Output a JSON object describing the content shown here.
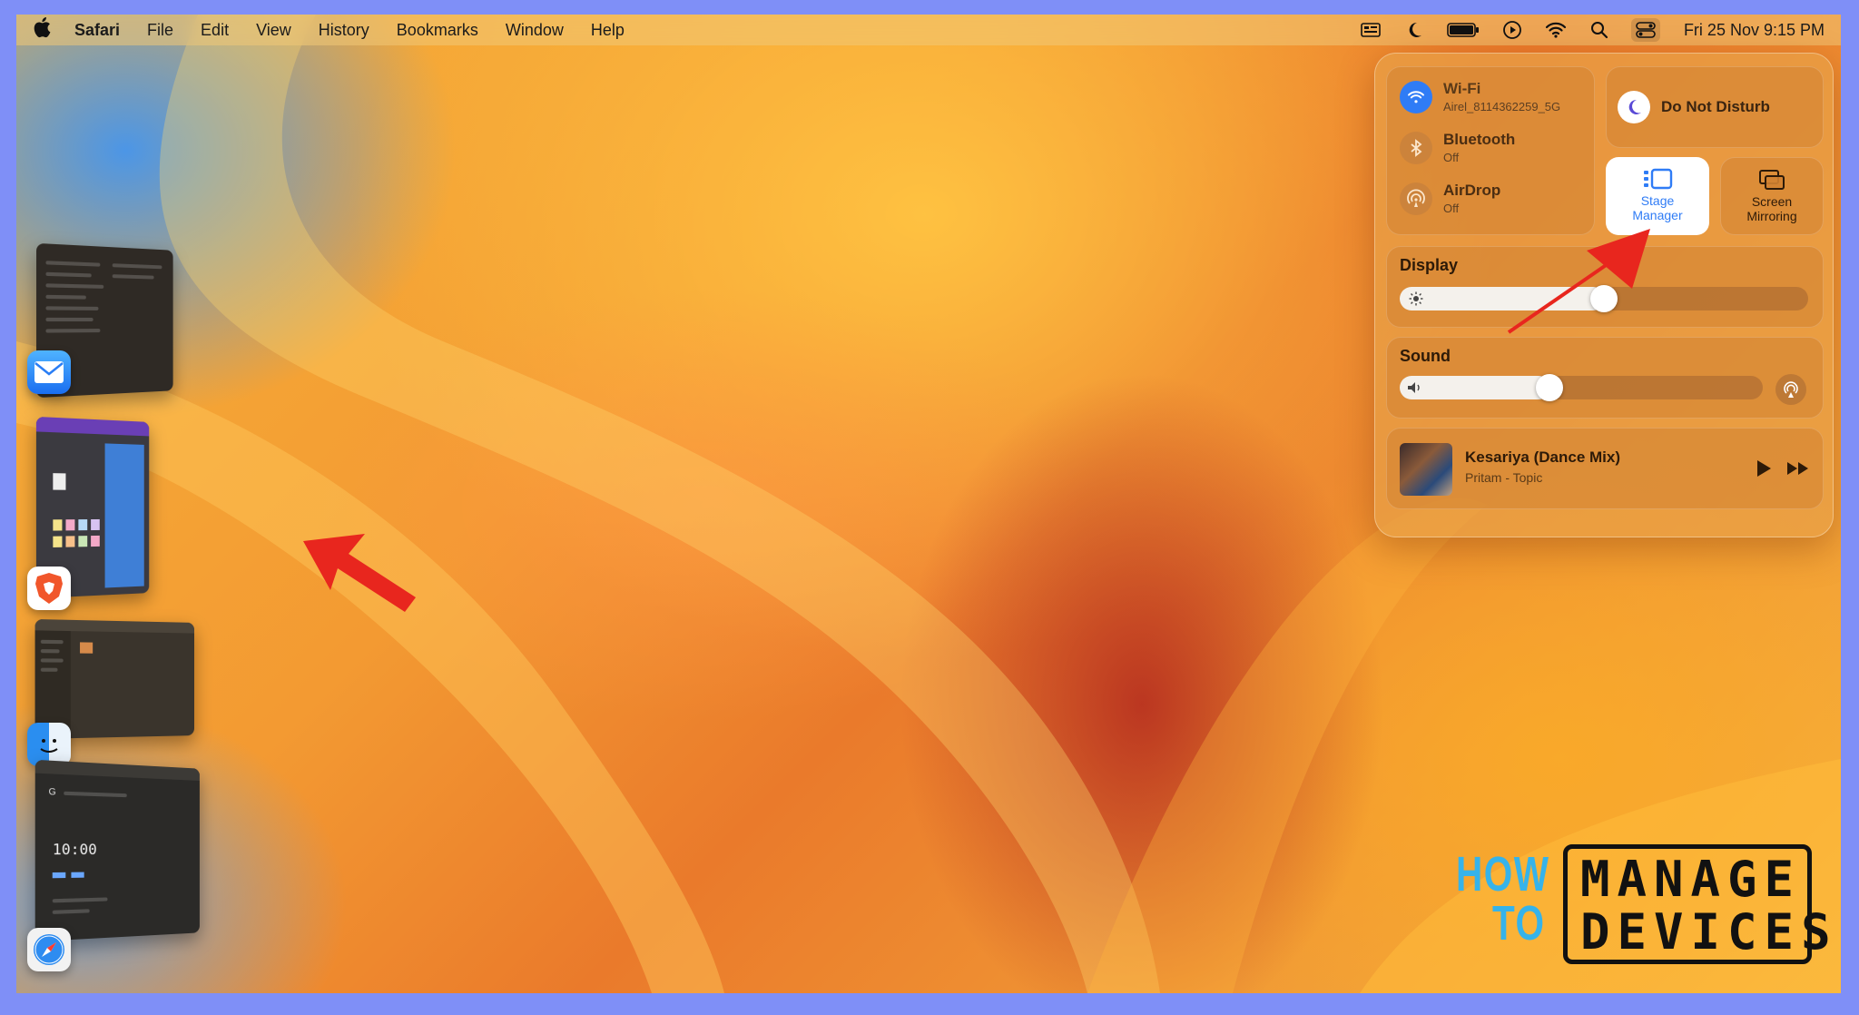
{
  "menubar": {
    "app_name": "Safari",
    "menus": [
      "File",
      "Edit",
      "View",
      "History",
      "Bookmarks",
      "Window",
      "Help"
    ],
    "clock": "Fri 25 Nov  9:15 PM"
  },
  "control_center": {
    "wifi": {
      "name": "Wi-Fi",
      "status": "Airel_8114362259_5G"
    },
    "bluetooth": {
      "name": "Bluetooth",
      "status": "Off"
    },
    "airdrop": {
      "name": "AirDrop",
      "status": "Off"
    },
    "do_not_disturb": {
      "label": "Do Not Disturb"
    },
    "stage_manager": {
      "label_line1": "Stage",
      "label_line2": "Manager",
      "active": true
    },
    "screen_mirroring": {
      "label_line1": "Screen",
      "label_line2": "Mirroring"
    },
    "display": {
      "title": "Display",
      "level": 0.47
    },
    "sound": {
      "title": "Sound",
      "level": 0.38
    },
    "now_playing": {
      "title": "Kesariya (Dance Mix)",
      "artist": "Pritam - Topic"
    }
  },
  "stage_apps": [
    "mail-icon",
    "brave-icon",
    "finder-icon",
    "safari-icon"
  ],
  "thumb_text": {
    "clock_text": "10:00"
  },
  "logo": {
    "how": "HOW",
    "to": "TO",
    "manage": "MANAGE",
    "devices": "DEVICES"
  },
  "colors": {
    "accent_blue": "#2f7cf6",
    "arrow_red": "#e8261e",
    "logo_blue": "#36b3ea"
  }
}
